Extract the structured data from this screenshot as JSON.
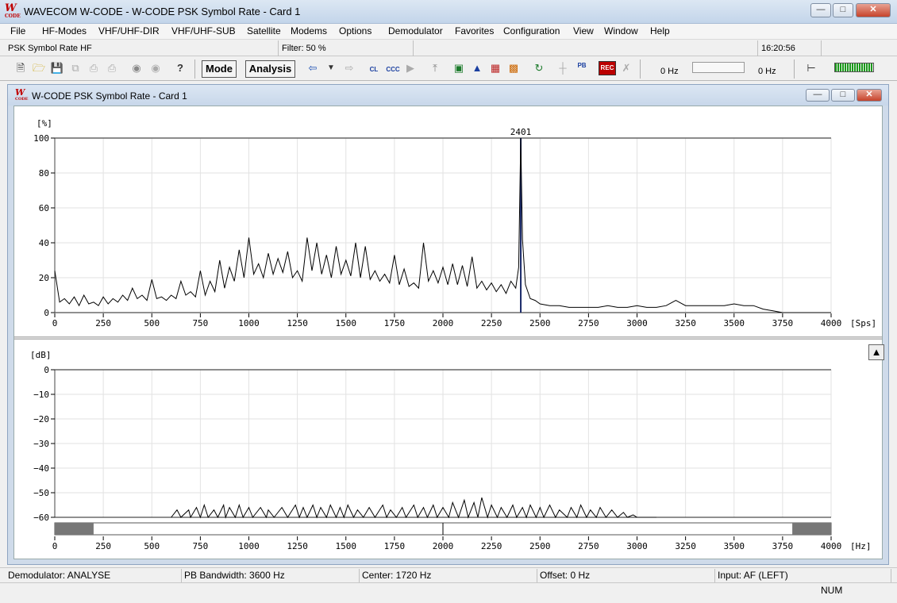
{
  "window": {
    "title": "WAVECOM W-CODE - W-CODE PSK Symbol Rate  - Card 1",
    "icon_letter": "W",
    "icon_sub": "CODE"
  },
  "menu": [
    "File",
    "HF-Modes",
    "VHF/UHF-DIR",
    "VHF/UHF-SUB",
    "Satellite",
    "Modems",
    "Options",
    "Demodulator",
    "Favorites",
    "Configuration",
    "View",
    "Window",
    "Help"
  ],
  "info": {
    "mode": "PSK Symbol Rate HF",
    "filter": "Filter: 50 %",
    "time": "16:20:56"
  },
  "toolbar": {
    "mode_label": "Mode",
    "analysis_label": "Analysis",
    "freq1": "0 Hz",
    "freq2": "0 Hz",
    "cl": "CL",
    "ccc": "CCC",
    "pb": "PB",
    "rec": "REC"
  },
  "child": {
    "title": "W-CODE PSK Symbol Rate  - Card 1"
  },
  "chart_data": [
    {
      "type": "line",
      "ylabel": "[%]",
      "xlabel": "[Sps]",
      "xlim": [
        0,
        4000
      ],
      "ylim": [
        0,
        100
      ],
      "xticks": [
        0,
        250,
        500,
        750,
        1000,
        1250,
        1500,
        1750,
        2000,
        2250,
        2500,
        2750,
        3000,
        3250,
        3500,
        3750,
        4000
      ],
      "yticks": [
        0,
        20,
        40,
        60,
        80,
        100
      ],
      "marker": {
        "x": 2401,
        "label": "2401"
      },
      "grid": true,
      "x": [
        0,
        25,
        50,
        75,
        100,
        125,
        150,
        175,
        200,
        225,
        250,
        275,
        300,
        325,
        350,
        375,
        400,
        425,
        450,
        475,
        500,
        525,
        550,
        575,
        600,
        625,
        650,
        675,
        700,
        725,
        750,
        775,
        800,
        825,
        850,
        875,
        900,
        925,
        950,
        975,
        1000,
        1025,
        1050,
        1075,
        1100,
        1125,
        1150,
        1175,
        1200,
        1225,
        1250,
        1275,
        1300,
        1325,
        1350,
        1375,
        1400,
        1425,
        1450,
        1475,
        1500,
        1525,
        1550,
        1575,
        1600,
        1625,
        1650,
        1675,
        1700,
        1725,
        1750,
        1775,
        1800,
        1825,
        1850,
        1875,
        1900,
        1925,
        1950,
        1975,
        2000,
        2025,
        2050,
        2075,
        2100,
        2125,
        2150,
        2175,
        2200,
        2225,
        2250,
        2275,
        2300,
        2325,
        2350,
        2375,
        2390,
        2401,
        2410,
        2425,
        2450,
        2475,
        2500,
        2550,
        2600,
        2650,
        2700,
        2750,
        2800,
        2850,
        2900,
        2950,
        3000,
        3050,
        3100,
        3150,
        3200,
        3250,
        3300,
        3350,
        3400,
        3450,
        3500,
        3550,
        3600,
        3650,
        3700,
        3750,
        3800,
        3850,
        3900,
        3950,
        4000
      ],
      "y": [
        24,
        6,
        8,
        5,
        9,
        4,
        10,
        5,
        6,
        4,
        9,
        5,
        8,
        6,
        10,
        7,
        14,
        8,
        10,
        7,
        19,
        8,
        9,
        7,
        10,
        8,
        18,
        10,
        12,
        9,
        24,
        10,
        18,
        12,
        30,
        14,
        26,
        18,
        36,
        20,
        43,
        22,
        28,
        20,
        34,
        22,
        31,
        23,
        35,
        20,
        24,
        18,
        43,
        24,
        40,
        22,
        33,
        20,
        38,
        22,
        30,
        21,
        40,
        20,
        38,
        19,
        24,
        18,
        22,
        17,
        33,
        16,
        25,
        15,
        17,
        14,
        40,
        18,
        24,
        17,
        26,
        16,
        28,
        16,
        27,
        15,
        32,
        14,
        18,
        13,
        17,
        12,
        16,
        11,
        18,
        14,
        26,
        100,
        42,
        16,
        8,
        7,
        5,
        4,
        4,
        3,
        3,
        3,
        3,
        4,
        3,
        3,
        4,
        3,
        3,
        4,
        7,
        4,
        4,
        4,
        4,
        4,
        5,
        4,
        4,
        2,
        1,
        0,
        0,
        0,
        0,
        0,
        0,
        0,
        0
      ]
    },
    {
      "type": "line",
      "ylabel": "[dB]",
      "xlabel": "[Hz]",
      "xlim": [
        0,
        4000
      ],
      "ylim": [
        -60,
        0
      ],
      "xticks": [
        0,
        250,
        500,
        750,
        1000,
        1250,
        1500,
        1750,
        2000,
        2250,
        2500,
        2750,
        3000,
        3250,
        3500,
        3750,
        4000
      ],
      "yticks": [
        0,
        -10,
        -20,
        -30,
        -40,
        -50,
        -60
      ],
      "passband": [
        200,
        3800
      ],
      "center_marker": 2000,
      "grid": true,
      "x": [
        600,
        630,
        650,
        690,
        700,
        730,
        750,
        770,
        790,
        820,
        840,
        870,
        880,
        900,
        930,
        950,
        970,
        1000,
        1020,
        1060,
        1090,
        1100,
        1130,
        1170,
        1200,
        1240,
        1260,
        1280,
        1300,
        1330,
        1350,
        1370,
        1400,
        1420,
        1450,
        1470,
        1490,
        1510,
        1540,
        1560,
        1590,
        1620,
        1650,
        1690,
        1710,
        1730,
        1760,
        1790,
        1810,
        1850,
        1870,
        1900,
        1920,
        1950,
        1970,
        2000,
        2030,
        2050,
        2080,
        2110,
        2130,
        2160,
        2180,
        2200,
        2230,
        2250,
        2280,
        2300,
        2330,
        2360,
        2380,
        2410,
        2430,
        2450,
        2480,
        2500,
        2520,
        2550,
        2580,
        2600,
        2640,
        2660,
        2690,
        2710,
        2740,
        2760,
        2790,
        2810,
        2840,
        2870,
        2900,
        2930,
        2950,
        2980,
        3000,
        3050,
        3100
      ],
      "y": [
        -60,
        -57,
        -60,
        -57,
        -60,
        -56,
        -60,
        -55,
        -60,
        -57,
        -60,
        -55,
        -60,
        -56,
        -60,
        -55,
        -60,
        -56,
        -60,
        -56,
        -60,
        -57,
        -60,
        -56,
        -60,
        -55,
        -60,
        -56,
        -60,
        -55,
        -60,
        -56,
        -60,
        -55,
        -60,
        -56,
        -60,
        -55,
        -60,
        -57,
        -60,
        -56,
        -60,
        -55,
        -60,
        -57,
        -60,
        -56,
        -60,
        -55,
        -60,
        -56,
        -60,
        -55,
        -60,
        -56,
        -60,
        -54,
        -60,
        -53,
        -60,
        -54,
        -60,
        -52,
        -60,
        -55,
        -60,
        -56,
        -60,
        -55,
        -60,
        -56,
        -60,
        -55,
        -60,
        -56,
        -60,
        -55,
        -60,
        -57,
        -60,
        -56,
        -60,
        -55,
        -60,
        -57,
        -60,
        -56,
        -60,
        -57,
        -60,
        -58,
        -60,
        -59,
        -60,
        -60,
        -60
      ]
    }
  ],
  "status": {
    "demodulator": "Demodulator: ANALYSE",
    "bandwidth": "PB Bandwidth: 3600 Hz",
    "center": "Center: 1720 Hz",
    "offset": "Offset: 0 Hz",
    "input": "Input: AF (LEFT)",
    "num": "NUM"
  }
}
